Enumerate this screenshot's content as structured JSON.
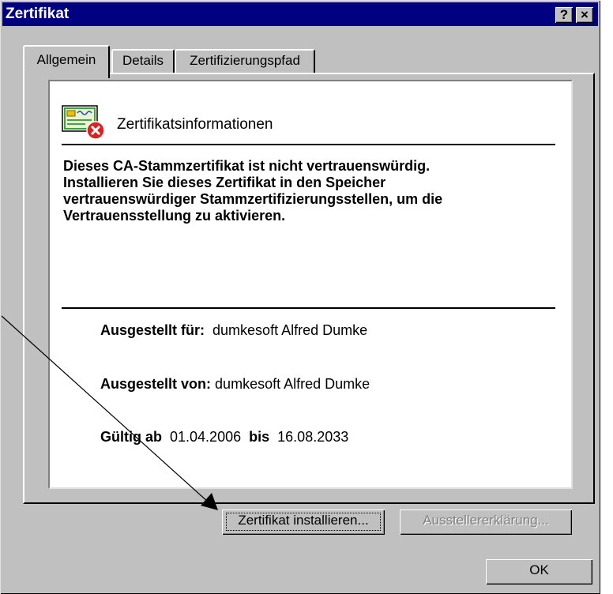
{
  "window": {
    "title": "Zertifikat",
    "help_button": "?",
    "close_button": "×"
  },
  "tabs": [
    {
      "label": "Allgemein",
      "active": true
    },
    {
      "label": "Details",
      "active": false
    },
    {
      "label": "Zertifizierungspfad",
      "active": false
    }
  ],
  "info": {
    "icon": "certificate-error-icon",
    "title": "Zertifikatsinformationen",
    "warning_lines": [
      "Dieses CA-Stammzertifikat ist nicht vertrauenswürdig.",
      "Installieren Sie dieses Zertifikat in den Speicher",
      "vertrauenswürdiger Stammzertifizierungsstellen, um die",
      "Vertrauensstellung zu aktivieren."
    ],
    "issued_to_label": "Ausgestellt für:",
    "issued_to_value": "dumkesoft Alfred Dumke",
    "issued_by_label": "Ausgestellt von:",
    "issued_by_value": "dumkesoft Alfred Dumke",
    "valid_from_label": "Gültig ab",
    "valid_from": "01.04.2006",
    "valid_to_label": "bis",
    "valid_to": "16.08.2033"
  },
  "buttons": {
    "install": "Zertifikat installieren...",
    "issuer_statement": "Ausstellererklärung...",
    "ok": "OK"
  },
  "colors": {
    "titlebar": "#000080",
    "face": "#c0c0c0",
    "error_badge": "#e02020"
  }
}
